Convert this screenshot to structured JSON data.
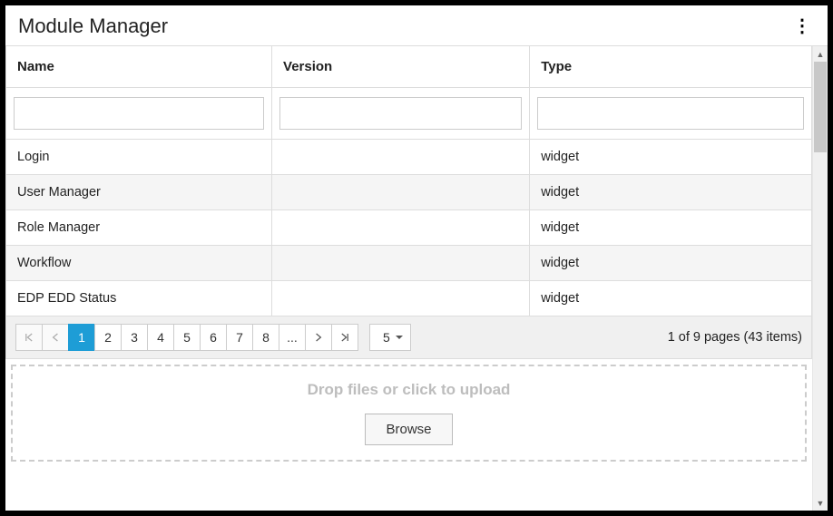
{
  "panel": {
    "title": "Module Manager"
  },
  "columns": {
    "name": "Name",
    "version": "Version",
    "type": "Type"
  },
  "filters": {
    "name": "",
    "version": "",
    "type": ""
  },
  "rows": [
    {
      "name": "Login",
      "version": "",
      "type": "widget"
    },
    {
      "name": "User Manager",
      "version": "",
      "type": "widget"
    },
    {
      "name": "Role Manager",
      "version": "",
      "type": "widget"
    },
    {
      "name": "Workflow",
      "version": "",
      "type": "widget"
    },
    {
      "name": "EDP EDD Status",
      "version": "",
      "type": "widget"
    }
  ],
  "pager": {
    "pages": [
      "1",
      "2",
      "3",
      "4",
      "5",
      "6",
      "7",
      "8",
      "..."
    ],
    "active": 0,
    "page_size": "5",
    "info": "1 of 9 pages (43 items)"
  },
  "upload": {
    "hint": "Drop files or click to upload",
    "browse_label": "Browse"
  }
}
